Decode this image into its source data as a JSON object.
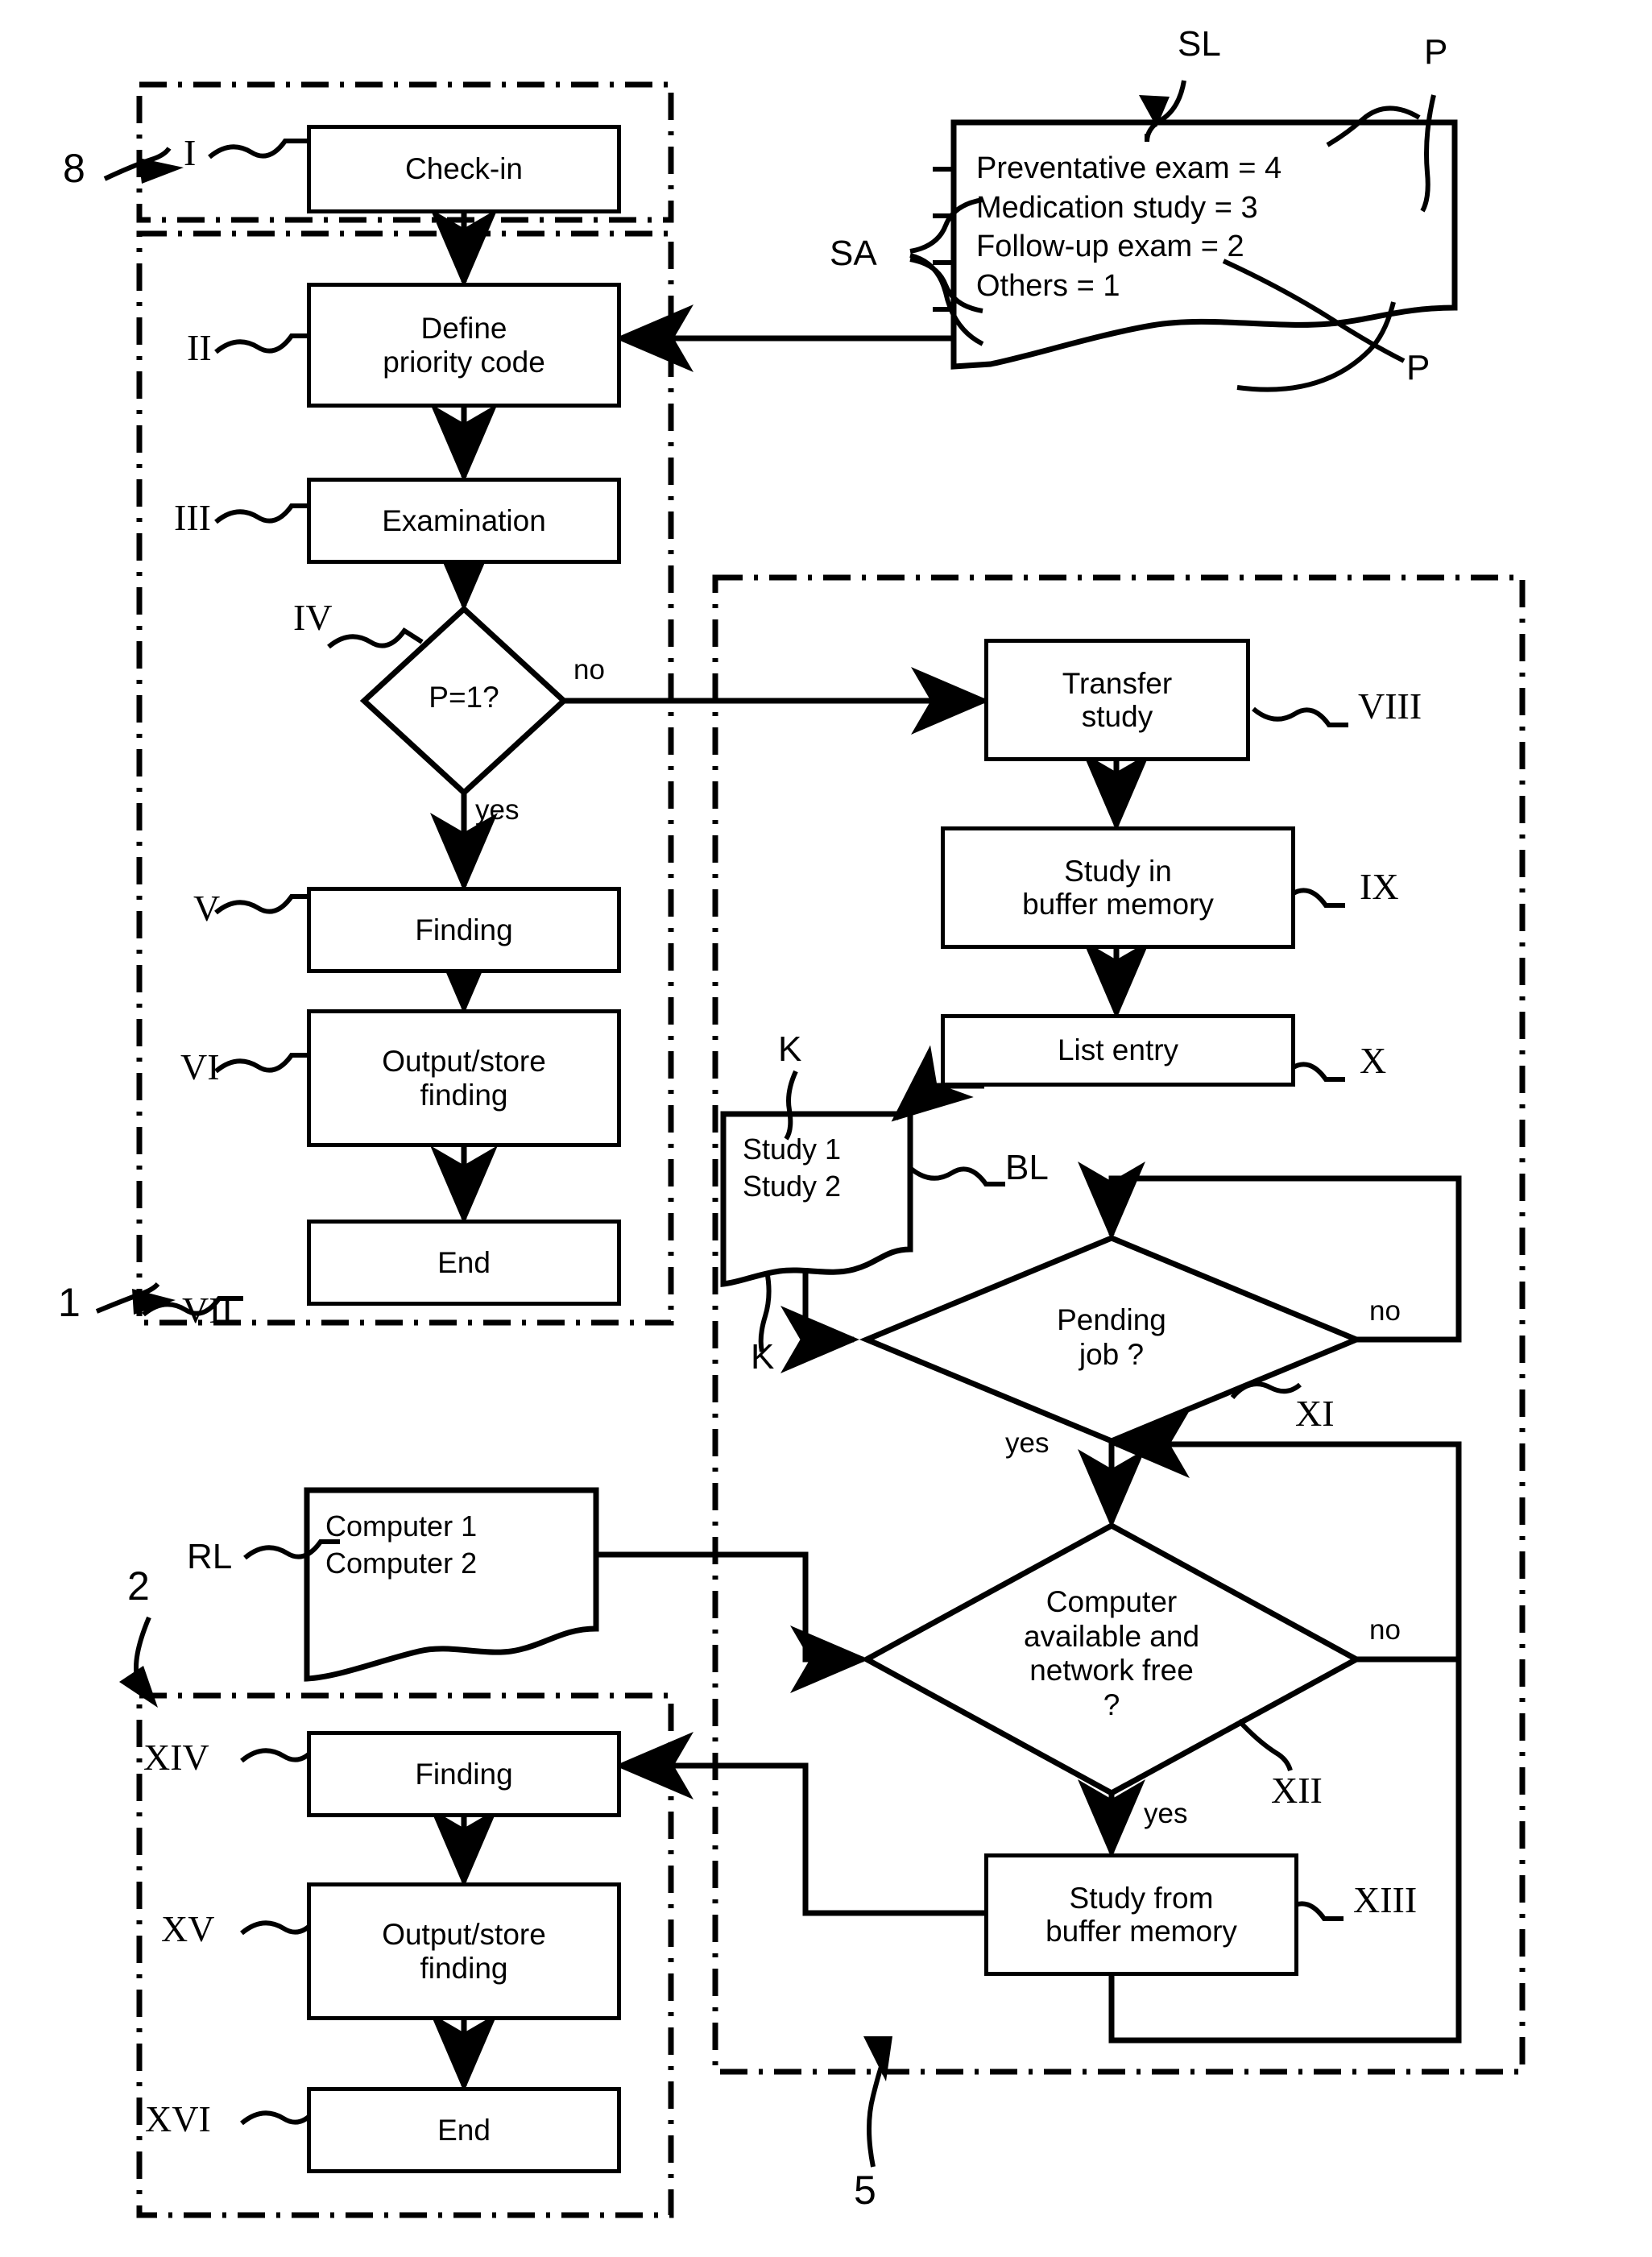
{
  "figure": {
    "type": "patent-flowchart",
    "regions": [
      {
        "id": "8",
        "label": "8"
      },
      {
        "id": "1",
        "label": "1"
      },
      {
        "id": "2",
        "label": "2"
      },
      {
        "id": "5",
        "label": "5"
      }
    ]
  },
  "nodes": {
    "I": {
      "ref": "I",
      "label": "Check-in"
    },
    "II": {
      "ref": "II",
      "label": "Define\npriority code"
    },
    "III": {
      "ref": "III",
      "label": "Examination"
    },
    "IV": {
      "ref": "IV",
      "label": "P=1?"
    },
    "V": {
      "ref": "V",
      "label": "Finding"
    },
    "VI": {
      "ref": "VI",
      "label": "Output/store\nfinding"
    },
    "VII": {
      "ref": "VII",
      "label": "End"
    },
    "VIII": {
      "ref": "VIII",
      "label": "Transfer\nstudy"
    },
    "IX": {
      "ref": "IX",
      "label": "Study in\nbuffer memory"
    },
    "X": {
      "ref": "X",
      "label": "List entry"
    },
    "XI": {
      "ref": "XI",
      "label": "Pending\njob ?"
    },
    "XII": {
      "ref": "XII",
      "label": "Computer\navailable and\nnetwork free\n?"
    },
    "XIII": {
      "ref": "XIII",
      "label": "Study from\nbuffer memory"
    },
    "XIV": {
      "ref": "XIV",
      "label": "Finding"
    },
    "XV": {
      "ref": "XV",
      "label": "Output/store\nfinding"
    },
    "XVI": {
      "ref": "XVI",
      "label": "End"
    }
  },
  "lists": {
    "SL": {
      "ref": "SL",
      "side_ref": "SA",
      "value_refs": [
        "P",
        "P"
      ],
      "entries": [
        "Preventative exam = 4",
        "Medication study = 3",
        "Follow-up exam = 2",
        "Others = 1"
      ],
      "text": "Preventative exam = 4\nMedication study = 3\nFollow-up exam = 2\nOthers = 1"
    },
    "BL": {
      "ref": "BL",
      "bracket_refs": [
        "K",
        "K"
      ],
      "entries": [
        "Study 1",
        "Study 2"
      ],
      "text": "Study 1\nStudy 2"
    },
    "RL": {
      "ref": "RL",
      "entries": [
        "Computer 1",
        "Computer 2"
      ],
      "text": "Computer 1\nComputer 2"
    }
  },
  "branches": {
    "IV_no": "no",
    "IV_yes": "yes",
    "XI_no": "no",
    "XI_yes": "yes",
    "XII_no": "no",
    "XII_yes": "yes"
  },
  "colors": {
    "stroke": "#000000",
    "background": "#ffffff"
  }
}
